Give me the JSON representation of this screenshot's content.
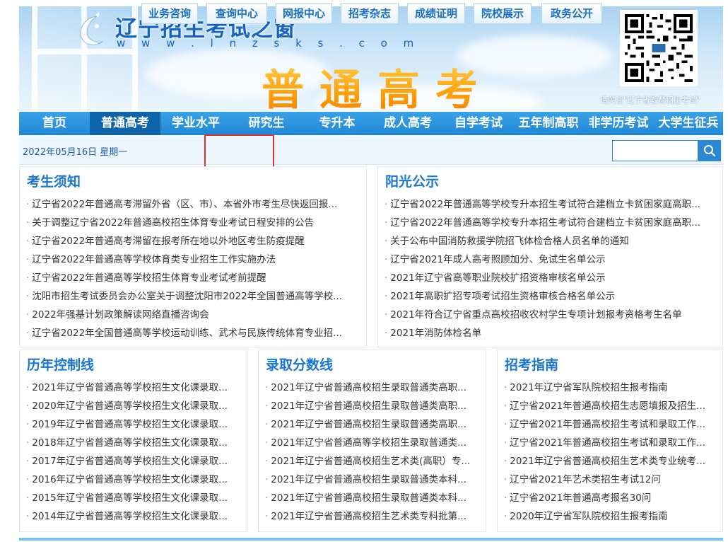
{
  "header": {
    "site_title": "辽宁招生考试之窗",
    "site_url": "w w w . l n z s k s . c o m",
    "big_title": "普通高考",
    "qr_caption": "请关注\"辽宁省教育招生考试\""
  },
  "main_nav": [
    {
      "label": "首页"
    },
    {
      "label": "普通高考"
    },
    {
      "label": "学业水平"
    },
    {
      "label": "研究生"
    },
    {
      "label": "专升本"
    },
    {
      "label": "成人高考"
    },
    {
      "label": "自学考试"
    },
    {
      "label": "五年制高职"
    },
    {
      "label": "非学历考试"
    },
    {
      "label": "大学生征兵"
    }
  ],
  "subbar": {
    "date": "2022年05月16日 星期一",
    "buttons": [
      {
        "label": "业务咨询"
      },
      {
        "label": "查询中心"
      },
      {
        "label": "网报中心"
      },
      {
        "label": "招考杂志"
      },
      {
        "label": "成绩证明"
      },
      {
        "label": "院校展示"
      },
      {
        "label": "政务公开"
      }
    ],
    "search_placeholder": ""
  },
  "panels": {
    "notice": {
      "title": "考生须知",
      "items": [
        "辽宁省2022年普通高考滞留外省（区、市）、本省外市考生尽快返回报...",
        "关于调整辽宁省2022年普通高校招生体育专业考试日程安排的公告",
        "辽宁省2022年普通高考滞留在报考所在地以外地区考生防疫提醒",
        "辽宁省2022年普通高等学校体育类专业招生工作实施办法",
        "辽宁省2022年普通高等学校招生体育专业考试考前提醒",
        "沈阳市招生考试委员会办公室关于调整沈阳市2022年全国普通高等学校...",
        "2022年强基计划政策解读网络直播咨询会",
        "辽宁省2022年全国普通高等学校运动训练、武术与民族传统体育专业招..."
      ]
    },
    "sunshine": {
      "title": "阳光公示",
      "items": [
        "辽宁省2022年普通高等学校专升本招生考试符合建档立卡贫困家庭高职...",
        "辽宁省2022年普通高等学校专升本招生考试符合建档立卡贫困家庭高职...",
        "关于公布中国消防救援学院招飞体检合格人员名单的通知",
        "辽宁省2021年成人高考照顾加分、免试生名单公示",
        "2021年辽宁省高等职业院校扩招资格审核名单公示",
        "2021年高职扩招专项考试招生资格审核合格名单公示",
        "2021年符合辽宁省重点高校招收农村学生专项计划报考资格考生名单",
        "2021年消防体检名单"
      ]
    },
    "control_line": {
      "title": "历年控制线",
      "items": [
        "2021年辽宁省普通高等学校招生文化课录取...",
        "2020年辽宁省普通高等学校招生文化课录取...",
        "2019年辽宁省普通高等学校招生文化课录取...",
        "2018年辽宁省普通高等学校招生文化课录取...",
        "2017年辽宁省普通高等学校招生文化课录取...",
        "2016年辽宁省普通高等学校招生文化课录取...",
        "2015年辽宁省普通高等学校招生文化课录取...",
        "2014年辽宁省普通高等学校招生文化课录取..."
      ]
    },
    "admission_score": {
      "title": "录取分数线",
      "items": [
        "2021年辽宁省普通高校招生录取普通类高职...",
        "2021年辽宁省普通高校招生录取普通类高职...",
        "2021年辽宁省普通高校招生录取普通类高职...",
        "2021年辽宁省普通高等学校招生录取普通类...",
        "2021年辽宁省普通高校招生艺术类(高职）专...",
        "2021年辽宁省普通高校招生录取普通类本科...",
        "2021年辽宁省普通高校招生录取普通类本科...",
        "2021年辽宁省普通高校招生艺术类专科批第..."
      ]
    },
    "guide": {
      "title": "招考指南",
      "items": [
        "2021年辽宁省军队院校招生报考指南",
        "辽宁省2021年普通高校招生志愿填报及招生...",
        "辽宁省2021年普通高校招生考试和录取工作...",
        "辽宁省2021年普通高校招生考试和录取工作...",
        "2021年辽宁省普通高校招生艺术类专业统考...",
        "辽宁省2021年艺术类招生考试12问",
        "辽宁省2021年普通高考报名30问",
        "2020年辽宁省军队院校招生报考指南"
      ]
    }
  },
  "colors": {
    "nav_blue": "#1f88d6",
    "nav_active": "#0f63a8",
    "title_blue": "#1976d2",
    "highlight_red": "#e0302b",
    "big_title_orange": "#ff9800"
  }
}
